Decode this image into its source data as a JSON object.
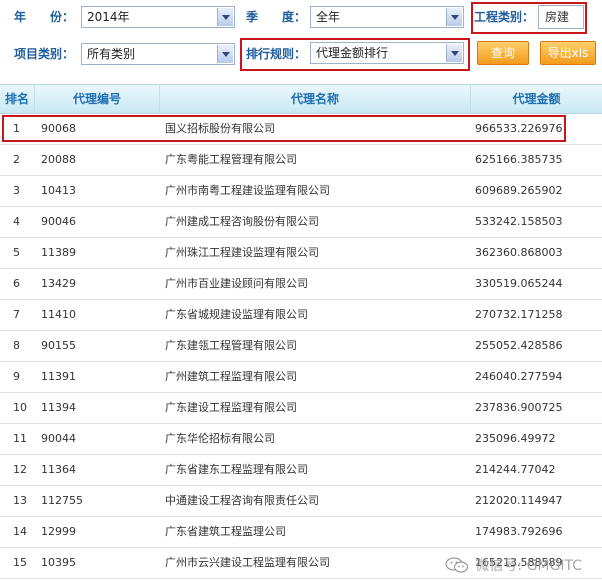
{
  "filters": {
    "year_label": "年　　份：",
    "year_value": "2014年",
    "quarter_label": "季　　度：",
    "quarter_value": "全年",
    "project_type_label": "工程类别：",
    "project_type_value": "房建",
    "item_type_label": "项目类别：",
    "item_type_value": "所有类别",
    "ranking_rule_label": "排行规则：",
    "ranking_rule_value": "代理金额排行",
    "query_button": "查询",
    "export_button": "导出xls"
  },
  "table": {
    "columns": [
      "排名",
      "代理编号",
      "代理名称",
      "代理金额"
    ],
    "rows": [
      {
        "rank": "1",
        "code": "90068",
        "name": "国义招标股份有限公司",
        "amount": "966533.226976"
      },
      {
        "rank": "2",
        "code": "20088",
        "name": "广东粤能工程管理有限公司",
        "amount": "625166.385735"
      },
      {
        "rank": "3",
        "code": "10413",
        "name": "广州市南粤工程建设监理有限公司",
        "amount": "609689.265902"
      },
      {
        "rank": "4",
        "code": "90046",
        "name": "广州建成工程咨询股份有限公司",
        "amount": "533242.158503"
      },
      {
        "rank": "5",
        "code": "11389",
        "name": "广州珠江工程建设监理有限公司",
        "amount": "362360.868003"
      },
      {
        "rank": "6",
        "code": "13429",
        "name": "广州市百业建设顾问有限公司",
        "amount": "330519.065244"
      },
      {
        "rank": "7",
        "code": "11410",
        "name": "广东省城规建设监理有限公司",
        "amount": "270732.171258"
      },
      {
        "rank": "8",
        "code": "90155",
        "name": "广东建瓴工程管理有限公司",
        "amount": "255052.428586"
      },
      {
        "rank": "9",
        "code": "11391",
        "name": "广州建筑工程监理有限公司",
        "amount": "246040.277594"
      },
      {
        "rank": "10",
        "code": "11394",
        "name": "广东建设工程监理有限公司",
        "amount": "237836.900725"
      },
      {
        "rank": "11",
        "code": "90044",
        "name": "广东华伦招标有限公司",
        "amount": "235096.49972"
      },
      {
        "rank": "12",
        "code": "11364",
        "name": "广东省建东工程监理有限公司",
        "amount": "214244.77042"
      },
      {
        "rank": "13",
        "code": "112755",
        "name": "中通建设工程咨询有限责任公司",
        "amount": "212020.114947"
      },
      {
        "rank": "14",
        "code": "12999",
        "name": "广东省建筑工程监理公司",
        "amount": "174983.792696"
      },
      {
        "rank": "15",
        "code": "10395",
        "name": "广州市云兴建设工程监理有限公司",
        "amount": "165213.588589"
      }
    ]
  },
  "watermark": {
    "text": "微信号: GMGITC",
    "icon": "wechat-icon"
  },
  "colors": {
    "highlight": "#c8161d",
    "label": "#1f5d9e",
    "header_text": "#1f6fb3",
    "button": "#f29b1d"
  }
}
